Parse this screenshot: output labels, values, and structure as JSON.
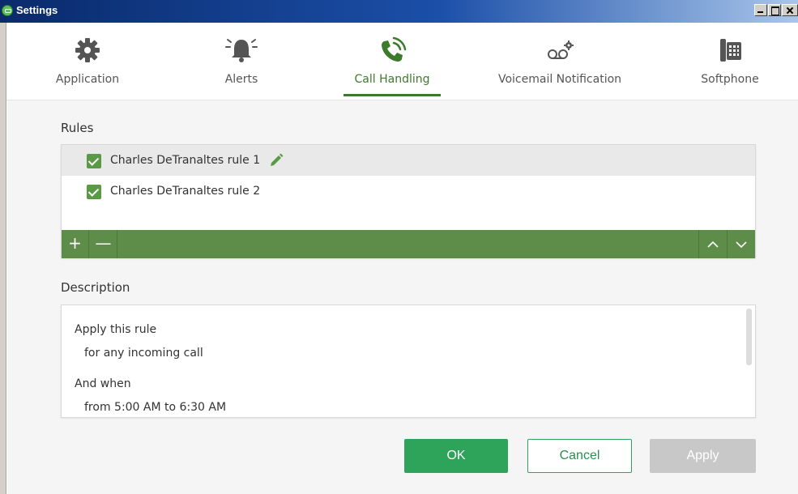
{
  "window": {
    "title": "Settings"
  },
  "tabs": [
    {
      "label": "Application",
      "icon": "gear-icon",
      "active": false
    },
    {
      "label": "Alerts",
      "icon": "bell-icon",
      "active": false
    },
    {
      "label": "Call Handling",
      "icon": "phone-call-icon",
      "active": true
    },
    {
      "label": "Voicemail Notification",
      "icon": "voicemail-icon",
      "active": false
    },
    {
      "label": "Softphone",
      "icon": "desk-phone-icon",
      "active": false
    }
  ],
  "rules": {
    "title": "Rules",
    "items": [
      {
        "label": "Charles DeTranaltes rule 1",
        "checked": true,
        "selected": true
      },
      {
        "label": "Charles DeTranaltes rule 2",
        "checked": true,
        "selected": false
      }
    ],
    "toolbar": {
      "add": "+",
      "remove": "—",
      "up": "︿",
      "down": "﹀"
    }
  },
  "description": {
    "title": "Description",
    "lines": [
      {
        "text": "Apply this rule",
        "kind": "heading"
      },
      {
        "text": "for any incoming call",
        "kind": "detail"
      },
      {
        "text": "And when",
        "kind": "heading"
      },
      {
        "text": "from 5:00 AM to 6:30 AM",
        "kind": "detail"
      }
    ]
  },
  "buttons": {
    "ok": "OK",
    "cancel": "Cancel",
    "apply": "Apply"
  },
  "colors": {
    "accent": "#3d7a2b",
    "toolbar": "#5e8c49",
    "ok_button": "#2ea35a",
    "disabled": "#c8c8c8"
  }
}
